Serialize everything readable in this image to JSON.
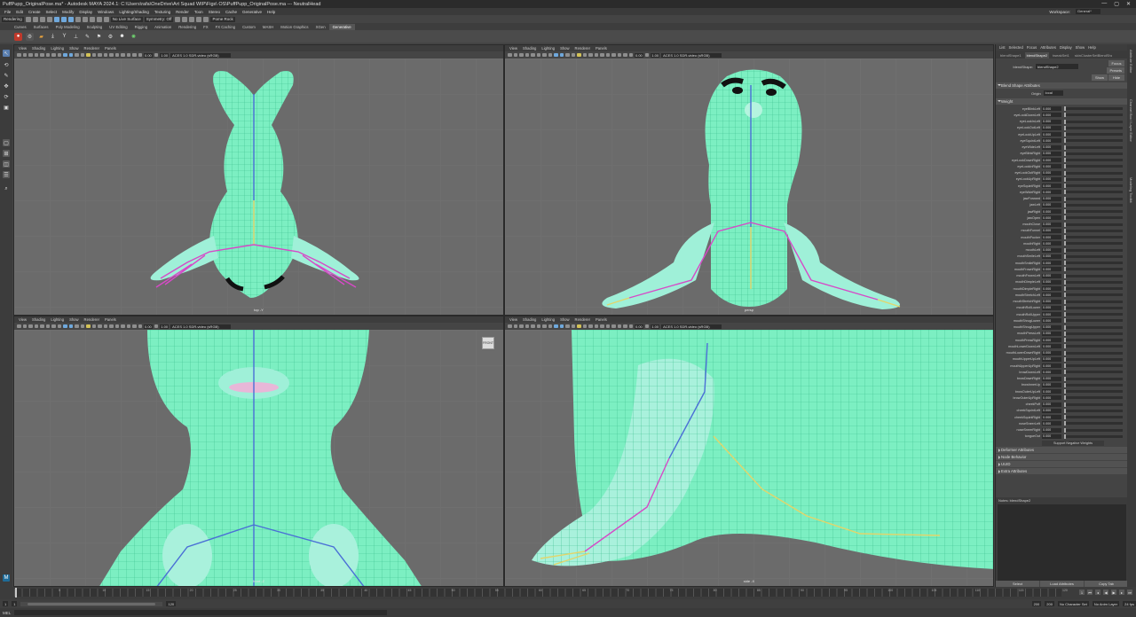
{
  "window": {
    "title": "PuffPupp_OriginalPose.ma* - Autodesk MAYA 2024.1: C:\\Users\\rafa\\OneDrive\\Art Squad WIP\\Figs\\ OS\\PuffPupp_OriginalPose.ma  ---  NeutralHead",
    "min": "—",
    "max": "▢",
    "close": "✕"
  },
  "menus": [
    "File",
    "Edit",
    "Create",
    "Select",
    "Modify",
    "Display",
    "Windows",
    "Lighting/Shading",
    "Texturing",
    "Render",
    "Toon",
    "Stereo",
    "Cache",
    "Generative",
    "Help"
  ],
  "workspace": {
    "label": "Workspace:",
    "value": "General*"
  },
  "status": {
    "mode": "Rendering",
    "surface": "No Live Surface",
    "symmetry": "Symmetry: Off",
    "posemenu": "Pome Rock"
  },
  "shelf_tabs": [
    "Curves",
    "Surfaces",
    "Poly Modeling",
    "Sculpting",
    "UV Editing",
    "Rigging",
    "Animation",
    "Rendering",
    "FX",
    "FX Caching",
    "Custom",
    "MASH",
    "Motion Graphics",
    "XGen",
    "Generative"
  ],
  "shelf_active": "Generative",
  "viewports": [
    {
      "menus": [
        "View",
        "Shading",
        "Lighting",
        "Show",
        "Renderer",
        "Panels"
      ],
      "num1": "0.00",
      "num2": "1.00",
      "colorspace": "ACES 1.0 SDR-video (sRGB)",
      "camera": "top -Y"
    },
    {
      "menus": [
        "View",
        "Shading",
        "Lighting",
        "Show",
        "Renderer",
        "Panels"
      ],
      "num1": "0.00",
      "num2": "1.00",
      "colorspace": "ACES 1.0 SDR-video (sRGB)",
      "camera": "persp"
    },
    {
      "menus": [
        "View",
        "Shading",
        "Lighting",
        "Show",
        "Renderer",
        "Panels"
      ],
      "num1": "0.00",
      "num2": "1.00",
      "colorspace": "ACES 1.0 SDR-video (sRGB)",
      "camera": "front -Z",
      "cube": "FRONT"
    },
    {
      "menus": [
        "View",
        "Shading",
        "Lighting",
        "Show",
        "Renderer",
        "Panels"
      ],
      "num1": "0.00",
      "num2": "1.00",
      "colorspace": "ACES 1.0 SDR-video (sRGB)",
      "camera": "side -X"
    }
  ],
  "attr": {
    "menus": [
      "List",
      "Selected",
      "Focus",
      "Attributes",
      "Display",
      "Show",
      "Help"
    ],
    "tabs": [
      "blendShape1",
      "blendShape2",
      "tweakSet1",
      "skinClusterSetBlendShape1",
      "polyBlendShape"
    ],
    "active_tab": "blendShape2",
    "node_label": "blendShape:",
    "node_value": "blendShape2",
    "focus": "Focus",
    "presets": "Presets",
    "show": "Show",
    "hide": "Hide",
    "sec_attrs": "Blend Shape Attributes",
    "origin_label": "Origin",
    "origin_value": "local",
    "sec_weight": "Weight",
    "weights": [
      [
        "eyeBlinkLeft",
        "0.000"
      ],
      [
        "eyeLookDownLeft",
        "0.000"
      ],
      [
        "eyeLookInLeft",
        "0.000"
      ],
      [
        "eyeLookOutLeft",
        "0.000"
      ],
      [
        "eyeLookUpLeft",
        "0.000"
      ],
      [
        "eyeSquintLeft",
        "0.000"
      ],
      [
        "eyeWideLeft",
        "0.000"
      ],
      [
        "eyeBlinkRight",
        "0.000"
      ],
      [
        "eyeLookDownRight",
        "0.000"
      ],
      [
        "eyeLookInRight",
        "0.000"
      ],
      [
        "eyeLookOutRight",
        "0.000"
      ],
      [
        "eyeLookUpRight",
        "0.000"
      ],
      [
        "eyeSquintRight",
        "0.000"
      ],
      [
        "eyeWideRight",
        "0.000"
      ],
      [
        "jawForward",
        "0.000"
      ],
      [
        "jawLeft",
        "0.000"
      ],
      [
        "jawRight",
        "0.000"
      ],
      [
        "jawOpen",
        "0.000"
      ],
      [
        "mouthClose",
        "0.000"
      ],
      [
        "mouthFunnel",
        "0.000"
      ],
      [
        "mouthPucker",
        "0.000"
      ],
      [
        "mouthRight",
        "0.000"
      ],
      [
        "mouthLeft",
        "0.000"
      ],
      [
        "mouthSmileLeft",
        "0.000"
      ],
      [
        "mouthSmileRight",
        "0.000"
      ],
      [
        "mouthFrownRight",
        "0.000"
      ],
      [
        "mouthFrownLeft",
        "0.000"
      ],
      [
        "mouthDimpleLeft",
        "0.000"
      ],
      [
        "mouthDimpleRight",
        "0.000"
      ],
      [
        "mouthStretchLeft",
        "0.000"
      ],
      [
        "mouthStretchRight",
        "0.000"
      ],
      [
        "mouthRollLower",
        "0.000"
      ],
      [
        "mouthRollUpper",
        "0.000"
      ],
      [
        "mouthShrugLower",
        "0.000"
      ],
      [
        "mouthShrugUpper",
        "0.000"
      ],
      [
        "mouthPressLeft",
        "0.000"
      ],
      [
        "mouthPressRight",
        "0.000"
      ],
      [
        "mouthLowerDownLeft",
        "0.000"
      ],
      [
        "mouthLowerDownRight",
        "0.000"
      ],
      [
        "mouthUpperUpLeft",
        "0.000"
      ],
      [
        "mouthUpperUpRight",
        "0.000"
      ],
      [
        "browDownLeft",
        "0.000"
      ],
      [
        "browDownRight",
        "0.000"
      ],
      [
        "browInnerUp",
        "0.000"
      ],
      [
        "browOuterUpLeft",
        "0.000"
      ],
      [
        "browOuterUpRight",
        "0.000"
      ],
      [
        "cheekPuff",
        "0.000"
      ],
      [
        "cheekSquintLeft",
        "0.000"
      ],
      [
        "cheekSquintRight",
        "0.000"
      ],
      [
        "noseSneerLeft",
        "0.000"
      ],
      [
        "noseSneerRight",
        "0.000"
      ],
      [
        "tongueOut",
        "0.000"
      ]
    ],
    "support": "Support Negative Weights",
    "sections": [
      "Deformer Attributes",
      "Node Behavior",
      "UUID",
      "Extra Attributes"
    ],
    "notes_label": "Notes: blendShape2",
    "btn_select": "Select",
    "btn_load": "Load Attributes",
    "btn_copy": "Copy Tab",
    "side_tabs": [
      "Attribute Editor",
      "Channel Box / Layer Editor",
      "Modeling Toolkit"
    ]
  },
  "timeline": {
    "ticks": [
      "1",
      "5",
      "10",
      "15",
      "20",
      "25",
      "30",
      "35",
      "40",
      "45",
      "50",
      "55",
      "60",
      "65",
      "70",
      "75",
      "80",
      "85",
      "90",
      "95",
      "100",
      "105",
      "110",
      "115",
      "120"
    ],
    "frame": "1"
  },
  "range": {
    "start": "1",
    "inner_start": "1",
    "inner_end": "120",
    "end": "200",
    "end2": "200",
    "fps": "24 fps",
    "character": "No Character Set",
    "anim_layer": "No Anim Layer"
  },
  "cmd": {
    "lang": "MEL"
  },
  "colors": {
    "mesh": "#7df0c0",
    "wire": "#33b98a",
    "joint_blue": "#4a6fd6",
    "joint_pink": "#d64ac7",
    "joint_yellow": "#e3d56a"
  }
}
